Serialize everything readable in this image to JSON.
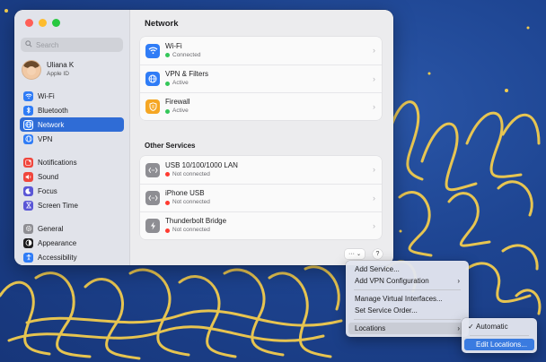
{
  "window": {
    "search_placeholder": "Search",
    "user": {
      "name": "Uliana K",
      "subtitle": "Apple ID"
    },
    "sidebar": [
      {
        "label": "Wi-Fi",
        "icon": "wifi-icon",
        "color": "#2f7cf6"
      },
      {
        "label": "Bluetooth",
        "icon": "bluetooth-icon",
        "color": "#2f7cf6"
      },
      {
        "label": "Network",
        "icon": "globe-icon",
        "color": "#2f7cf6",
        "selected": true
      },
      {
        "label": "VPN",
        "icon": "vpn-icon",
        "color": "#2f7cf6"
      },
      {
        "label": "Notifications",
        "icon": "bell-icon",
        "color": "#f0463c"
      },
      {
        "label": "Sound",
        "icon": "speaker-icon",
        "color": "#f0463c"
      },
      {
        "label": "Focus",
        "icon": "moon-icon",
        "color": "#5a56d6"
      },
      {
        "label": "Screen Time",
        "icon": "hourglass-icon",
        "color": "#5a56d6"
      },
      {
        "label": "General",
        "icon": "gear-icon",
        "color": "#8e8e93"
      },
      {
        "label": "Appearance",
        "icon": "appearance-icon",
        "color": "#1c1c1e"
      },
      {
        "label": "Accessibility",
        "icon": "accessibility-icon",
        "color": "#2f7cf6"
      }
    ]
  },
  "main": {
    "title": "Network",
    "services": [
      {
        "name": "Wi-Fi",
        "status": "Connected",
        "status_color": "#34c759",
        "icon": "wifi-icon",
        "color": "#2f7cf6"
      },
      {
        "name": "VPN & Filters",
        "status": "Active",
        "status_color": "#34c759",
        "icon": "vpn-filters-icon",
        "color": "#2f7cf6"
      },
      {
        "name": "Firewall",
        "status": "Active",
        "status_color": "#34c759",
        "icon": "firewall-icon",
        "color": "#f5a623"
      }
    ],
    "other_title": "Other Services",
    "other": [
      {
        "name": "USB 10/100/1000 LAN",
        "status": "Not connected",
        "status_color": "#ff3b30",
        "icon": "ethernet-icon"
      },
      {
        "name": "iPhone USB",
        "status": "Not connected",
        "status_color": "#ff3b30",
        "icon": "ethernet-icon"
      },
      {
        "name": "Thunderbolt Bridge",
        "status": "Not connected",
        "status_color": "#ff3b30",
        "icon": "thunderbolt-icon"
      }
    ],
    "more_label": "···",
    "help_label": "?"
  },
  "menu": {
    "add_service": "Add Service...",
    "add_vpn": "Add VPN Configuration",
    "manage_virtual": "Manage Virtual Interfaces...",
    "set_order": "Set Service Order...",
    "locations": "Locations"
  },
  "submenu": {
    "automatic": "Automatic",
    "check": "✓",
    "edit_locations": "Edit Locations..."
  }
}
